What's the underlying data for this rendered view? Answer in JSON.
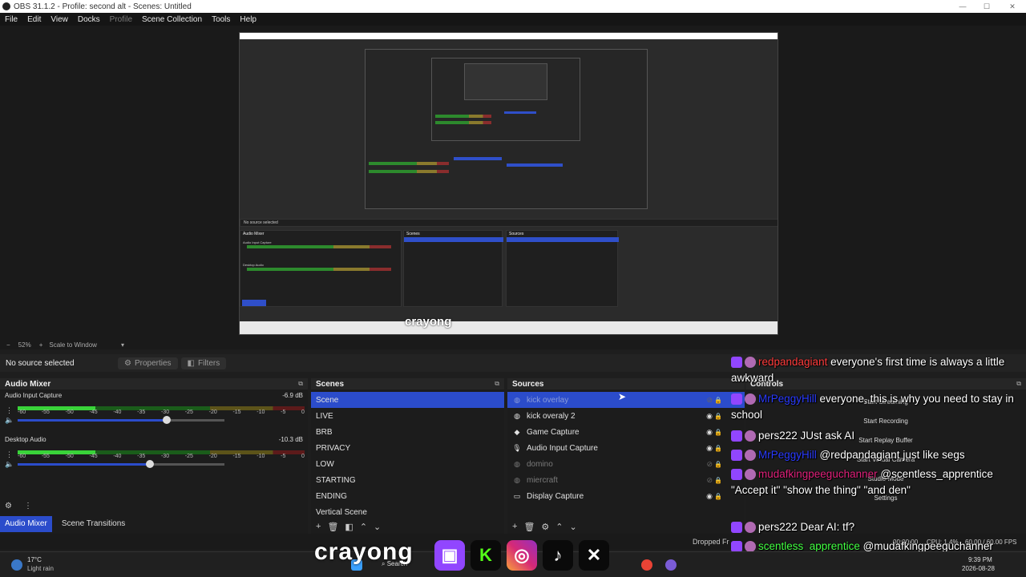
{
  "window": {
    "title": "OBS 31.1.2 - Profile: second alt - Scenes: Untitled"
  },
  "menu": {
    "items": [
      "File",
      "Edit",
      "View",
      "Docks",
      "Profile",
      "Scene Collection",
      "Tools",
      "Help"
    ]
  },
  "preview": {
    "zoom": "52%",
    "scale_mode": "Scale to Window",
    "nested_labels": {
      "no_source": "No source selected",
      "audio_mixer": "Audio Mixer",
      "scenes": "Scenes",
      "sources": "Sources",
      "audio_input_capture": "Audio Input Capture",
      "desktop_audio": "Desktop Audio"
    }
  },
  "source_bar": {
    "no_source": "No source selected",
    "properties": "Properties",
    "filters": "Filters"
  },
  "audio_mixer": {
    "title": "Audio Mixer",
    "channels": [
      {
        "name": "Audio Input Capture",
        "db": "-6.9 dB",
        "level": 0.27,
        "volume": 0.72
      },
      {
        "name": "Desktop Audio",
        "db": "-10.3 dB",
        "level": 0.27,
        "volume": 0.64
      }
    ],
    "scale": [
      "-60",
      "-55",
      "-50",
      "-45",
      "-40",
      "-35",
      "-30",
      "-25",
      "-20",
      "-15",
      "-10",
      "-5",
      "0"
    ]
  },
  "scenes": {
    "title": "Scenes",
    "items": [
      "Scene",
      "LIVE",
      "BRB",
      "PRIVACY",
      "LOW",
      "STARTING",
      "ENDING",
      "Vertical Scene"
    ],
    "selected": 0
  },
  "sources": {
    "title": "Sources",
    "items": [
      {
        "name": "kick overlay",
        "icon": "globe",
        "visible": false,
        "selected": true
      },
      {
        "name": "kick overaly 2",
        "icon": "globe",
        "visible": true
      },
      {
        "name": "Game Capture",
        "icon": "gamepad",
        "visible": true
      },
      {
        "name": "Audio Input Capture",
        "icon": "mic",
        "visible": true
      },
      {
        "name": "domino",
        "icon": "globe",
        "visible": false
      },
      {
        "name": "miercraft",
        "icon": "globe",
        "visible": false
      },
      {
        "name": "Display Capture",
        "icon": "monitor",
        "visible": true
      }
    ]
  },
  "controls": {
    "title": "Controls",
    "buttons": [
      "Start Streaming",
      "Start Recording",
      "Start Replay Buffer",
      "Start Virtual Camera",
      "Studio Mode",
      "Settings"
    ]
  },
  "bottom_tabs": {
    "audio_mixer": "Audio Mixer",
    "scene_transitions": "Scene Transitions"
  },
  "chat": [
    {
      "user": "redpandagiant",
      "user_color": "#ff3b3b",
      "text": "everyone's first time is always a little awkward"
    },
    {
      "user": "MrPeggyHill",
      "user_color": "#2a3bff",
      "text": "everyone, this is why you need to stay in school"
    },
    {
      "user": "pers222",
      "user_color": "#ffffff",
      "text": "JUst ask AI"
    },
    {
      "user": "MrPeggyHill",
      "user_color": "#2a3bff",
      "text": "@redpandagiant just like segs"
    },
    {
      "user": "mudafkingpeeguchanner",
      "user_color": "#e0207a",
      "text": "@scentless_apprentice \"Accept it\" \"show the thing\" \"and den\""
    },
    {
      "user": "pers222",
      "user_color": "#ffffff",
      "text": "Dear AI: tf?"
    },
    {
      "user": "scentless_apprentice",
      "user_color": "#42ff42",
      "text": "@mudafkingpeeguchanner"
    }
  ],
  "status": {
    "dropped": "Dropped Fr",
    "time": "00:00:00",
    "cpu": "CPU: 1.4%",
    "fps": "60.00 / 60.00 FPS"
  },
  "taskbar": {
    "weather_temp": "17°C",
    "weather_desc": "Light rain",
    "search": "Search",
    "clock_time": "9:39 PM",
    "clock_date": "2026-08-28"
  },
  "overlay": {
    "brand": "crayong"
  },
  "colors": {
    "accent": "#2b4ccb",
    "twitch": "#9146ff",
    "kick": "#53fc18"
  }
}
